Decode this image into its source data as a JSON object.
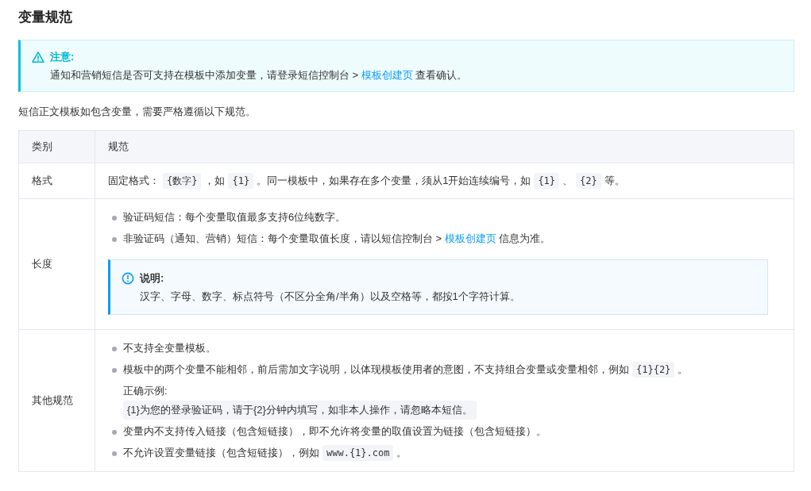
{
  "title": "变量规范",
  "notice": {
    "kind": "warning",
    "heading": "注意:",
    "body": [
      {
        "kind": "text",
        "text": "通知和营销短信是否可支持在模板中添加变量，请登录短信控制台 > "
      },
      {
        "kind": "link",
        "text": "模板创建页"
      },
      {
        "kind": "text",
        "text": " 查看确认。"
      }
    ]
  },
  "intro": "短信正文模板如包含变量，需要严格遵循以下规范。",
  "table": {
    "columns": [
      "类别",
      "规范"
    ],
    "rows": [
      {
        "category": "格式",
        "content": [
          {
            "kind": "paragraph",
            "segments": [
              {
                "kind": "text",
                "text": "固定格式："
              },
              {
                "kind": "code",
                "text": "{数字}"
              },
              {
                "kind": "text",
                "text": "，如"
              },
              {
                "kind": "code",
                "text": "{1}"
              },
              {
                "kind": "text",
                "text": "。同一模板中，如果存在多个变量，须从1开始连续编号，如"
              },
              {
                "kind": "code",
                "text": "{1}"
              },
              {
                "kind": "text",
                "text": "、"
              },
              {
                "kind": "code",
                "text": "{2}"
              },
              {
                "kind": "text",
                "text": "等。"
              }
            ]
          }
        ]
      },
      {
        "category": "长度",
        "content": [
          {
            "kind": "bullet",
            "segments": [
              {
                "kind": "text",
                "text": "验证码短信：每个变量取值最多支持6位纯数字。"
              }
            ]
          },
          {
            "kind": "bullet",
            "segments": [
              {
                "kind": "text",
                "text": "非验证码（通知、营销）短信：每个变量取值长度，请以短信控制台 > "
              },
              {
                "kind": "link",
                "text": "模板创建页"
              },
              {
                "kind": "text",
                "text": " 信息为准。"
              }
            ]
          },
          {
            "kind": "info_note",
            "heading": "说明:",
            "body": [
              {
                "kind": "text",
                "text": "汉字、字母、数字、标点符号（不区分全角/半角）以及空格等，都按1个字符计算。"
              }
            ]
          }
        ]
      },
      {
        "category": "其他规范",
        "content": [
          {
            "kind": "bullet",
            "segments": [
              {
                "kind": "text",
                "text": "不支持全变量模板。"
              }
            ]
          },
          {
            "kind": "bullet",
            "segments": [
              {
                "kind": "text",
                "text": "模板中的两个变量不能相邻，前后需加文字说明，以体现模板使用者的意图，不支持组合变量或变量相邻，例如"
              },
              {
                "kind": "code",
                "text": "{1}{2}"
              },
              {
                "kind": "text",
                "text": "。"
              }
            ]
          },
          {
            "kind": "example",
            "label": "正确示例:",
            "code": "{1}为您的登录验证码，请于{2}分钟内填写，如非本人操作，请忽略本短信。"
          },
          {
            "kind": "bullet",
            "segments": [
              {
                "kind": "text",
                "text": "变量内不支持传入链接（包含短链接），即不允许将变量的取值设置为链接（包含短链接）。"
              }
            ]
          },
          {
            "kind": "bullet",
            "segments": [
              {
                "kind": "text",
                "text": "不允许设置变量链接（包含短链接），例如"
              },
              {
                "kind": "code",
                "text": "www.{1}.com"
              },
              {
                "kind": "text",
                "text": "。"
              }
            ]
          }
        ]
      }
    ]
  }
}
